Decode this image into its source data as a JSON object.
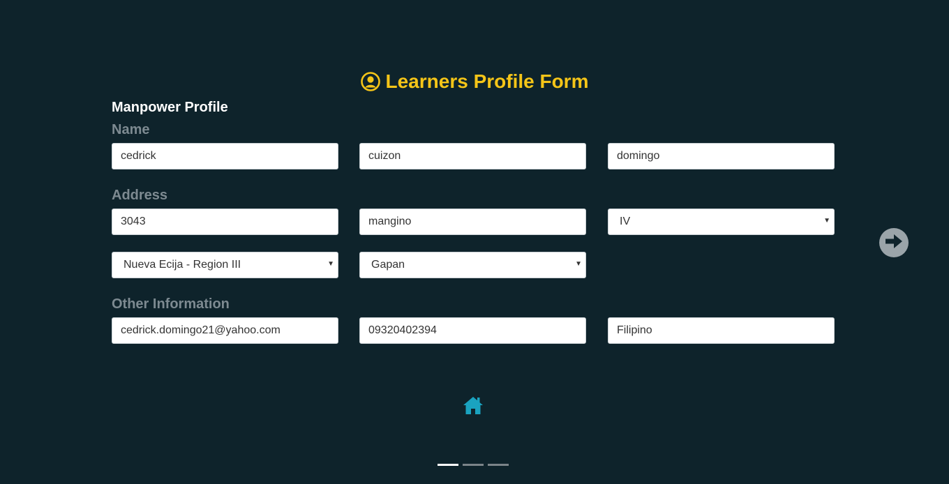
{
  "form": {
    "title": "Learners Profile Form",
    "title_icon": "user-circle-icon",
    "section_title": "Manpower Profile"
  },
  "name_group": {
    "label": "Name",
    "first": "cedrick",
    "middle": "cuizon",
    "last": "domingo"
  },
  "address_group": {
    "label": "Address",
    "street_number": "3043",
    "barangay": "mangino",
    "district": "IV",
    "province": "Nueva Ecija - Region III",
    "city": "Gapan"
  },
  "other_group": {
    "label": "Other Information",
    "email": "cedrick.domingo21@yahoo.com",
    "contact": "09320402394",
    "nationality": "Filipino"
  },
  "navigation": {
    "next_icon": "arrow-right-circle-icon",
    "home_icon": "home-icon",
    "pager": [
      true,
      false,
      false
    ]
  },
  "colors": {
    "background": "#0e232b",
    "accent": "#f5c518",
    "home": "#1aa3c0"
  }
}
